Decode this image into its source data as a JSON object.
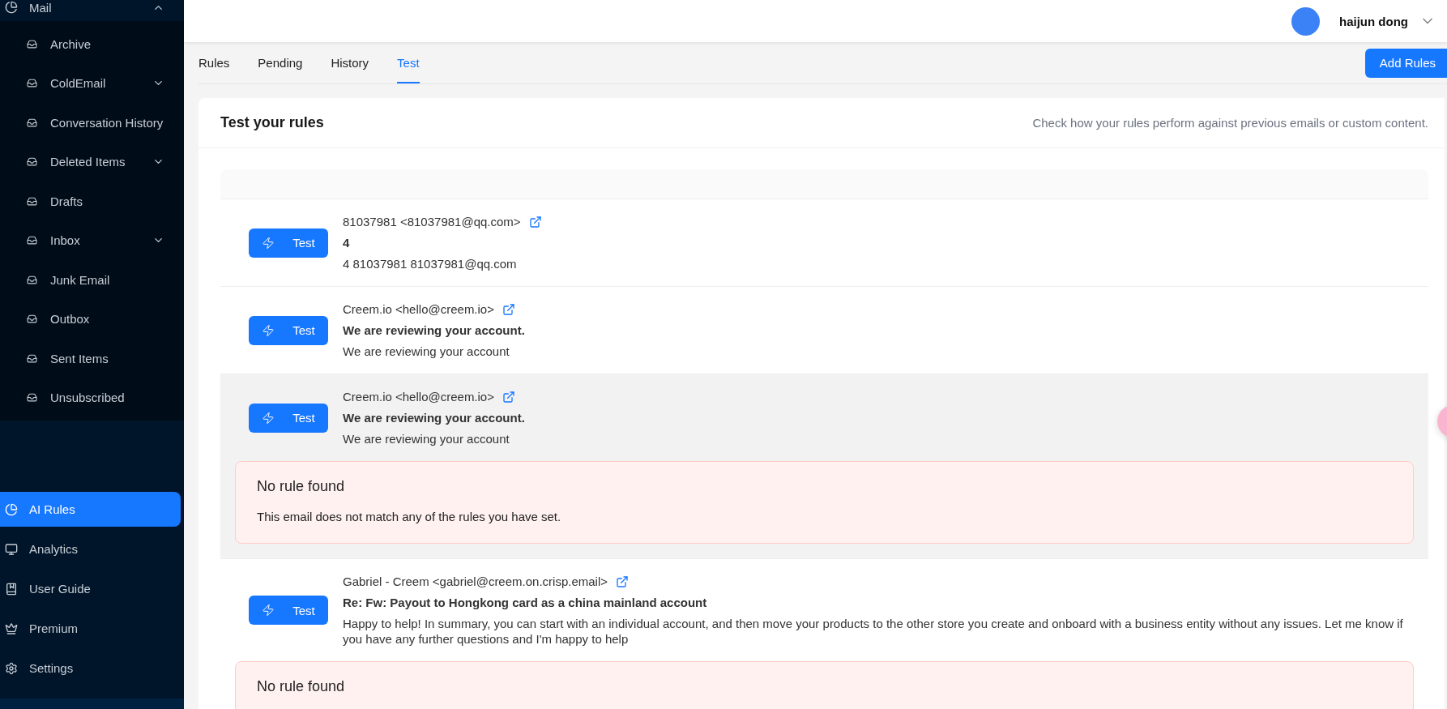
{
  "sidebar": {
    "group": {
      "label": "Mail",
      "expanded": true,
      "items": [
        {
          "label": "Archive",
          "has_children": false
        },
        {
          "label": "ColdEmail",
          "has_children": true
        },
        {
          "label": "Conversation History",
          "has_children": false
        },
        {
          "label": "Deleted Items",
          "has_children": true
        },
        {
          "label": "Drafts",
          "has_children": false
        },
        {
          "label": "Inbox",
          "has_children": true
        },
        {
          "label": "Junk Email",
          "has_children": false
        },
        {
          "label": "Outbox",
          "has_children": false
        },
        {
          "label": "Sent Items",
          "has_children": false
        },
        {
          "label": "Unsubscribed",
          "has_children": false
        }
      ]
    },
    "nav": [
      {
        "label": "AI Rules",
        "selected": true
      },
      {
        "label": "Analytics",
        "selected": false
      },
      {
        "label": "User Guide",
        "selected": false
      },
      {
        "label": "Premium",
        "selected": false
      },
      {
        "label": "Settings",
        "selected": false
      }
    ]
  },
  "header": {
    "user": "haijun dong"
  },
  "tabs": [
    {
      "label": "Rules",
      "selected": false
    },
    {
      "label": "Pending",
      "selected": false
    },
    {
      "label": "History",
      "selected": false
    },
    {
      "label": "Test",
      "selected": true
    }
  ],
  "add_button": "Add Rules",
  "card": {
    "title": "Test your rules",
    "subtitle": "Check how your rules perform against previous emails or custom content.",
    "emails": [
      {
        "button": "Test",
        "sender": "81037981 <81037981@qq.com>",
        "subject": "4",
        "preview": "4 81037981 81037981@qq.com",
        "selected": false
      },
      {
        "button": "Test",
        "sender": "Creem.io <hello@creem.io>",
        "subject": "We are reviewing your account.",
        "preview": "We are reviewing your account",
        "selected": false
      },
      {
        "button": "Test",
        "sender": "Creem.io <hello@creem.io>",
        "subject": "We are reviewing your account.",
        "preview": "We are reviewing your account",
        "selected": true,
        "result": {
          "title": "No rule found",
          "message": "This email does not match any of the rules you have set."
        }
      },
      {
        "button": "Test",
        "sender": "Gabriel - Creem <gabriel@creem.on.crisp.email>",
        "subject": "Re: Fw: Payout to Hongkong card as a china mainland account",
        "preview": "Happy to help! In summary, you can start with an individual account, and then move your products to the other store you create and onboard with a business entity without any issues. Let me know if you have any further questions and I'm happy to help",
        "selected": false,
        "result": {
          "title": "No rule found"
        }
      }
    ]
  }
}
